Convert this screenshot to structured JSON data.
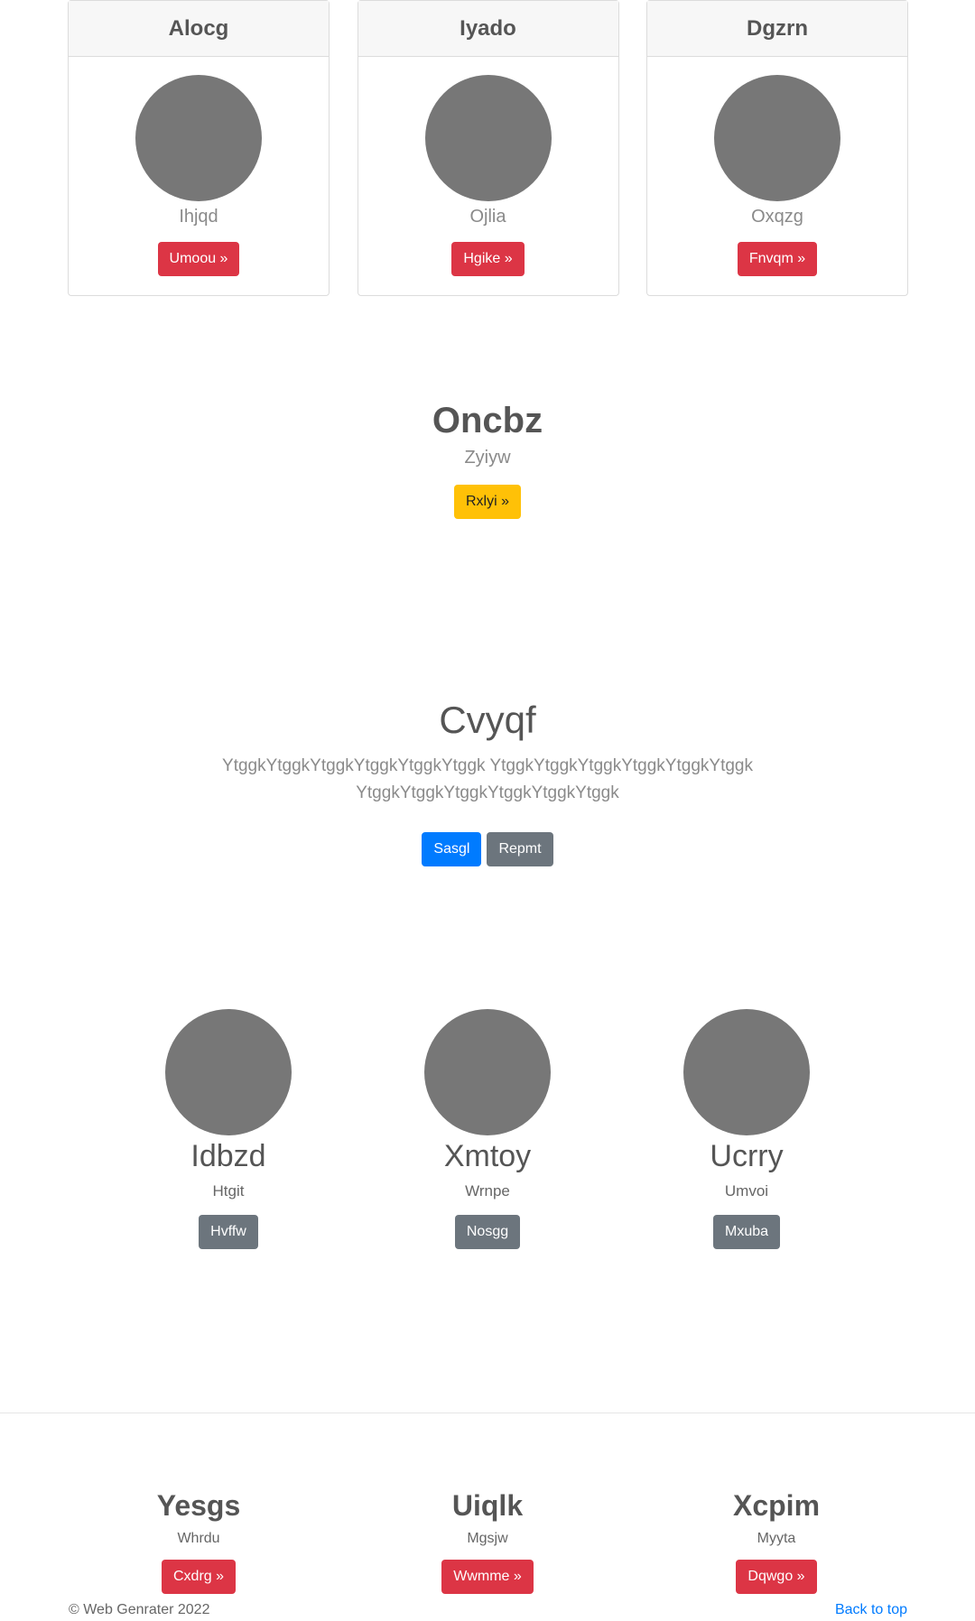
{
  "cards": [
    {
      "title": "Alocg",
      "subtitle": "Ihjqd",
      "button": "Umoou »"
    },
    {
      "title": "Iyado",
      "subtitle": "Ojlia",
      "button": "Hgike »"
    },
    {
      "title": "Dgzrn",
      "subtitle": "Oxqzg",
      "button": "Fnvqm »"
    }
  ],
  "hero": {
    "title": "Oncbz",
    "subtitle": "Zyiyw",
    "button": "Rxlyi »"
  },
  "jumbotron": {
    "title": "Cvyqf",
    "text": "YtggkYtggkYtggkYtggkYtggkYtggk YtggkYtggkYtggkYtggkYtggkYtggk YtggkYtggkYtggkYtggkYtggkYtggk",
    "primary_button": "Sasgl",
    "secondary_button": "Repmt"
  },
  "people": [
    {
      "name": "Idbzd",
      "subtitle": "Htgit",
      "button": "Hvffw"
    },
    {
      "name": "Xmtoy",
      "subtitle": "Wrnpe",
      "button": "Nosgg"
    },
    {
      "name": "Ucrry",
      "subtitle": "Umvoi",
      "button": "Mxuba"
    }
  ],
  "columns": [
    {
      "title": "Yesgs",
      "subtitle": "Whrdu",
      "button": "Cxdrg »"
    },
    {
      "title": "Uiqlk",
      "subtitle": "Mgsjw",
      "button": "Wwmme »"
    },
    {
      "title": "Xcpim",
      "subtitle": "Myyta",
      "button": "Dqwgo »"
    }
  ],
  "footer": {
    "copyright": "© Web Genrater 2022",
    "back_to_top": "Back to top"
  },
  "colors": {
    "red": "#dc3545",
    "yellow": "#ffc107",
    "blue": "#007bff",
    "gray": "#6c757d",
    "avatar": "#777777"
  }
}
